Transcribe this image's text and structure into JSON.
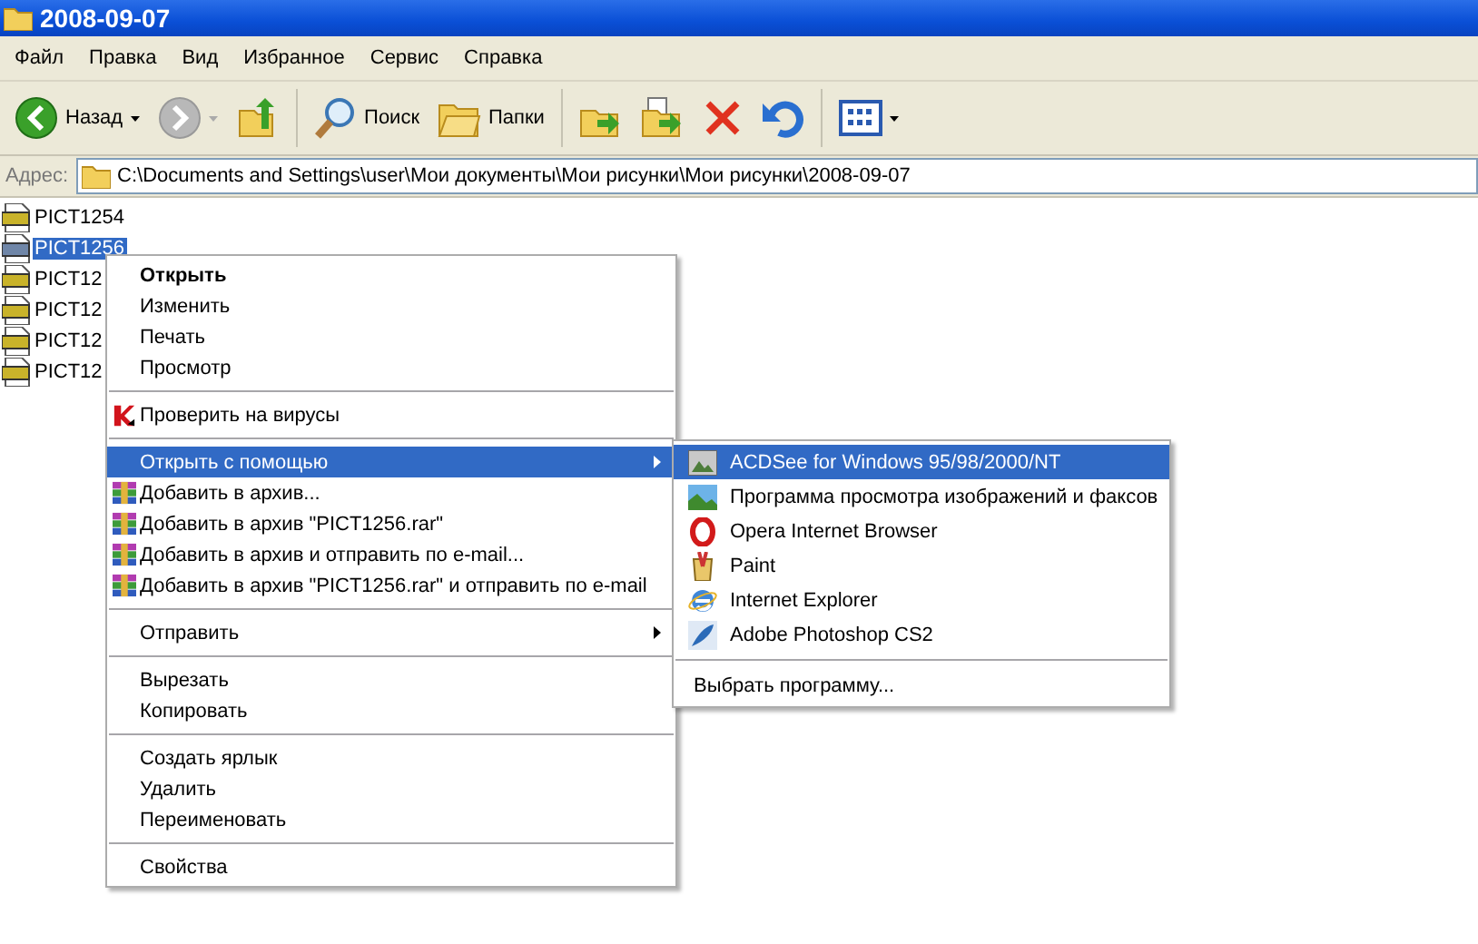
{
  "window": {
    "title": "2008-09-07"
  },
  "menu_bar": [
    "Файл",
    "Правка",
    "Вид",
    "Избранное",
    "Сервис",
    "Справка"
  ],
  "toolbar": [
    {
      "kind": "back",
      "label": "Назад",
      "disabled": false
    },
    {
      "kind": "forward",
      "disabled": true
    },
    {
      "kind": "up"
    },
    {
      "kind": "search",
      "label": "Поиск"
    },
    {
      "kind": "folders",
      "label": "Папки"
    },
    {
      "kind": "move"
    },
    {
      "kind": "copy"
    },
    {
      "kind": "delete"
    },
    {
      "kind": "undo"
    },
    {
      "kind": "views"
    }
  ],
  "address_bar": {
    "label": "Адрес:",
    "value": "C:\\Documents and Settings\\user\\Мои документы\\Мои рисунки\\Мои рисунки\\2008-09-07"
  },
  "files": [
    {
      "name": "PICT1254",
      "selected": false
    },
    {
      "name": "PICT1256",
      "selected": true
    },
    {
      "name": "PICT12",
      "selected": false
    },
    {
      "name": "PICT12",
      "selected": false
    },
    {
      "name": "PICT12",
      "selected": false
    },
    {
      "name": "PICT12",
      "selected": false
    }
  ],
  "context_menu": [
    {
      "kind": "plain",
      "label": "Открыть",
      "default": true,
      "selected": false
    },
    {
      "kind": "plain",
      "label": "Изменить",
      "default": false,
      "selected": false
    },
    {
      "kind": "plain",
      "label": "Печать",
      "default": false,
      "selected": false
    },
    {
      "kind": "plain",
      "label": "Просмотр",
      "default": false,
      "selected": false
    },
    {
      "kind": "separator"
    },
    {
      "kind": "antivirus",
      "label": "Проверить на вирусы",
      "default": false,
      "selected": false
    },
    {
      "kind": "separator"
    },
    {
      "kind": "submenu",
      "label": "Открыть с помощью",
      "default": false,
      "selected": true
    },
    {
      "kind": "archive",
      "label": "Добавить в архив...",
      "default": false,
      "selected": false
    },
    {
      "kind": "archive",
      "label": "Добавить в архив \"PICT1256.rar\"",
      "default": false,
      "selected": false
    },
    {
      "kind": "archive",
      "label": "Добавить в архив и отправить по e-mail...",
      "default": false,
      "selected": false
    },
    {
      "kind": "archive",
      "label": "Добавить в архив \"PICT1256.rar\" и отправить по e-mail",
      "default": false,
      "selected": false
    },
    {
      "kind": "separator"
    },
    {
      "kind": "submenu",
      "label": "Отправить",
      "default": false,
      "selected": false
    },
    {
      "kind": "separator"
    },
    {
      "kind": "plain",
      "label": "Вырезать",
      "default": false,
      "selected": false
    },
    {
      "kind": "plain",
      "label": "Копировать",
      "default": false,
      "selected": false
    },
    {
      "kind": "separator"
    },
    {
      "kind": "plain",
      "label": "Создать ярлык",
      "default": false,
      "selected": false
    },
    {
      "kind": "plain",
      "label": "Удалить",
      "default": false,
      "selected": false
    },
    {
      "kind": "plain",
      "label": "Переименовать",
      "default": false,
      "selected": false
    },
    {
      "kind": "separator"
    },
    {
      "kind": "plain",
      "label": "Свойства",
      "default": false,
      "selected": false
    }
  ],
  "open_with_menu": [
    {
      "kind": "app",
      "label": "ACDSee for Windows 95/98/2000/NT",
      "selected": true
    },
    {
      "kind": "app",
      "label": "Программа просмотра изображений и факсов",
      "selected": false
    },
    {
      "kind": "app",
      "label": "Opera Internet Browser",
      "selected": false
    },
    {
      "kind": "app",
      "label": "Paint",
      "selected": false
    },
    {
      "kind": "app",
      "label": "Internet Explorer",
      "selected": false
    },
    {
      "kind": "app",
      "label": "Adobe Photoshop CS2",
      "selected": false
    },
    {
      "kind": "separator"
    },
    {
      "kind": "plain",
      "label": "Выбрать программу...",
      "selected": false
    }
  ]
}
